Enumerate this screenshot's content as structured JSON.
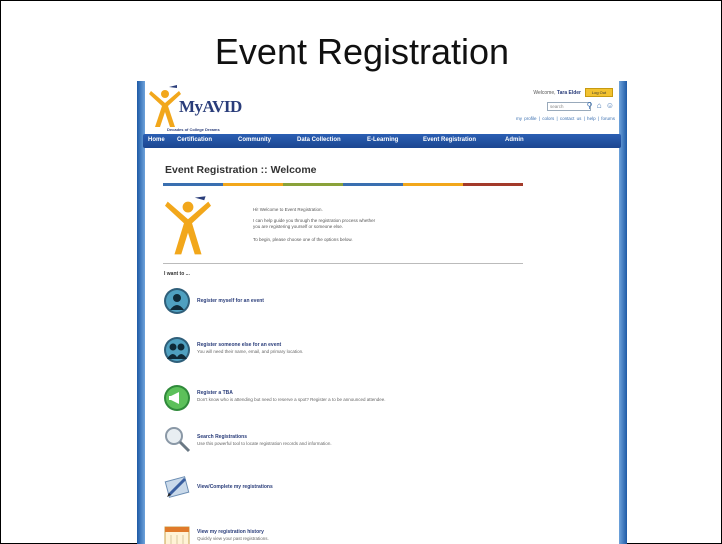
{
  "slide_title": "Event Registration",
  "header": {
    "logo_text": "MyAVID",
    "logo_tagline": "Decades of College Dreams",
    "welcome_prefix": "Welcome,",
    "user_name": "Tara Elder",
    "logout_label": "Log Out",
    "search_placeholder": "search",
    "links": "my profile | colors | contact us | help | forums"
  },
  "nav": {
    "items": [
      "Home",
      "Certification",
      "Community",
      "Data Collection",
      "E-Learning",
      "Event Registration",
      "Admin"
    ]
  },
  "page": {
    "title": "Event Registration :: Welcome",
    "intro": [
      "Hi! Welcome to Event Registration.",
      "I can help guide you through the registration process whether",
      "you are registering yourself or someone else.",
      "To begin, please choose one of the options below."
    ],
    "i_want_to": "I want to ..."
  },
  "options": [
    {
      "title": "Register myself for an event",
      "subtitle": "",
      "icon": "person-icon"
    },
    {
      "title": "Register someone else for an event",
      "subtitle": "You will need their name, email, and primary location.",
      "icon": "people-icon"
    },
    {
      "title": "Register a TBA",
      "subtitle": "Don't know who is attending but need to reserve a spot? Register a to be announced attendee.",
      "icon": "megaphone-icon"
    },
    {
      "title": "Search Registrations",
      "subtitle": "Use this powerful tool to locate registration records and information.",
      "icon": "magnifier-icon"
    },
    {
      "title": "View/Complete my registrations",
      "subtitle": "",
      "icon": "edit-icon"
    },
    {
      "title": "View my registration history",
      "subtitle": "Quickly view your past registrations.",
      "icon": "calendar-icon"
    }
  ],
  "colors": {
    "nav_blue": "#1f4f9e",
    "brand_navy": "#2a3d7a",
    "accent_orange": "#f2a71b",
    "logout_yellow": "#f2c230"
  }
}
